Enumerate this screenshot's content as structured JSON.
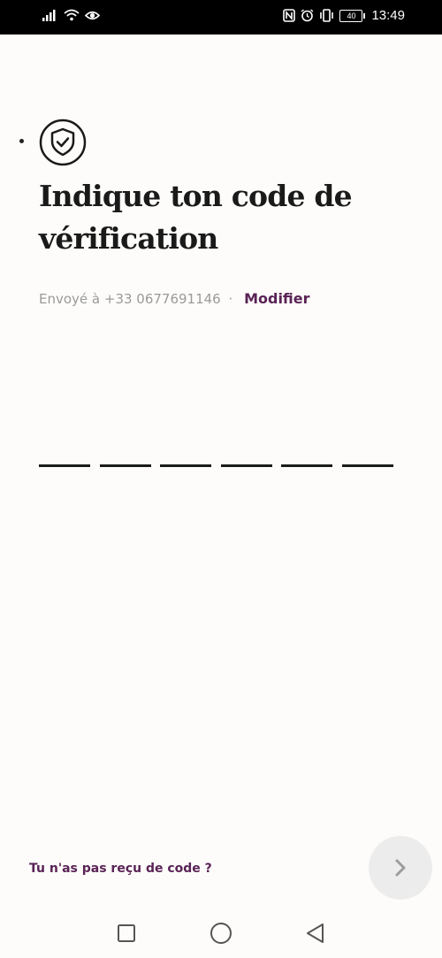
{
  "status_bar": {
    "time": "13:49",
    "battery": "40",
    "icons": [
      "signal-icon",
      "wifi-icon",
      "eye-icon",
      "nfc-icon",
      "alarm-icon",
      "vibrate-icon",
      "battery-icon"
    ]
  },
  "header": {
    "icon": "shield-check-icon",
    "title": "Indique ton code de vérification"
  },
  "sent_info": {
    "prefix": "Envoyé à +33 0677691146",
    "separator": "·",
    "modify_label": "Modifier"
  },
  "code": {
    "length": 6,
    "slots": [
      "",
      "",
      "",
      "",
      "",
      ""
    ]
  },
  "footer": {
    "resend_label": "Tu n'as pas reçu de code ?",
    "next_icon": "chevron-right-icon"
  },
  "nav": {
    "icons": [
      "square-icon",
      "circle-icon",
      "triangle-back-icon"
    ]
  },
  "colors": {
    "accent": "#5a2356",
    "text": "#1a1a1a",
    "muted": "#9a9a9a",
    "background": "#fdfcfa",
    "button_bg": "#ececec"
  }
}
